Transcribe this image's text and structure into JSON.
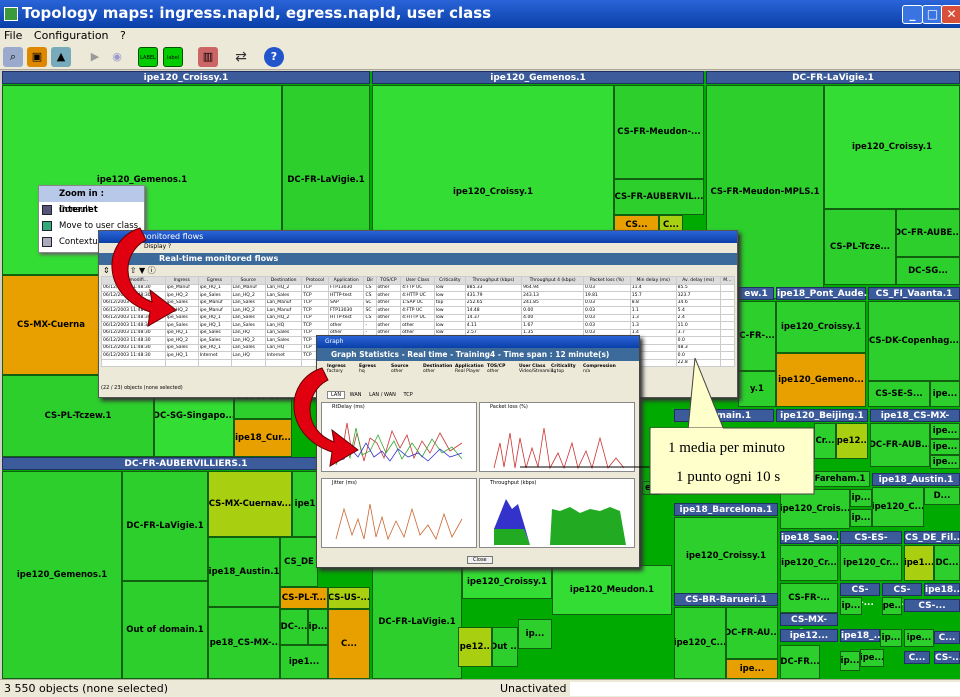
{
  "window": {
    "title": "Topology maps: ingress.napId, egress.napId, user class",
    "min": "_",
    "max": "□",
    "close": "✕"
  },
  "menu": [
    "File",
    "Configuration",
    "?"
  ],
  "toolbar": {
    "icons": [
      "search-icon",
      "lock-icon",
      "map-icon",
      "play-icon",
      "refresh-icon",
      "label-icon",
      "label2-icon",
      "filter-icon",
      "swap-icon",
      "help-icon"
    ]
  },
  "tree": {
    "headers": [
      "ipe120_Croissy.1",
      "ipe120_Gemenos.1",
      "DC-FR-LaVigie.1",
      "DC-FR-AUBERVILLIERS.1"
    ],
    "cells": [
      "ipe120_Gemenos.1",
      "DC-FR-LaVigie.1",
      "ipe120_Croissy.1",
      "CS-FR-Meudon-...",
      "CS-FR-AUBERVIL...",
      "CS-FR-Meudon-MPLS.1",
      "ipe120_Croissy.1",
      "DC-FR-AUBE...",
      "CS-PL-Tcze...",
      "DC-SG...",
      "CS...",
      "C...",
      "CS-MX-Cuerna",
      "ew.1",
      "ipe18_Pont_Aude...",
      "CS_FI_Vaanta.1",
      "ipe120_Croissy.1",
      "CS-DK-Copenhag...",
      "C-FR-...",
      "ipe120_Gemeno...",
      "CS-SE-S...",
      "ip...",
      "ipe...",
      "CS-PL-Tczew.1",
      "DC-SG-Singapo...",
      "Out of do...",
      "ipe18_Cur...",
      "y.1",
      "f domain.1",
      "ipe120_Beijing.1",
      "ipe18_CS-MX-Izt...",
      "ipe12...",
      "Cr...",
      "DC-FR-AUB...",
      "ipe...",
      "ipe...",
      "ipe...",
      "ipe120_Gemenos.1",
      "DC-FR-LaVigie.1",
      "CS-MX-Cuernav...",
      "ipe1",
      "ipe18_Austin.1",
      "CS_DE",
      "CS-PL-T...",
      "CS-US-...",
      "Out of domain.1",
      "ipe18_CS-MX-...",
      "DC-...",
      "ip...",
      "ipe1...",
      "C...",
      "ipe120_Croissy.1",
      "ipe120_Meudon.1",
      "DC-FR-LaVigie.1",
      "ipe12...",
      "Out ...",
      "ip...",
      "Fareham.1",
      "ipe18_Austin.1",
      "ip...",
      "D...",
      "ip...",
      "ipe120_Crois...",
      "ipe120_C...",
      "ipe18_Barcelona.1",
      "ipe18_Sao...",
      "CS-ES-Madr...",
      "CS_DE_Fil...",
      "ipe120_Croissy.1",
      "ipe120_Cr...",
      "ipe120_Cr...",
      "ipe1...",
      "DC...",
      "CS-US-...",
      "CS-FR...",
      "ipe18...",
      "CS-BR-Barueri.1",
      "CS-FR-...",
      "ip...",
      "CS-MX-Cu...",
      "ipe...",
      "CS-...",
      "ipe120_C...",
      "DC-FR-AU...",
      "ipe12...",
      "ipe18_...",
      "ip...",
      "ipe...",
      "C...",
      "DC-FR...",
      "ipe...",
      "ipe...",
      "C...",
      "CS-...",
      "ip...",
      "eu"
    ]
  },
  "context_menu": {
    "items": [
      "Zoom in : internet",
      "Consult",
      "Move to user class",
      "Contextual fl..."
    ]
  },
  "flows_window": {
    "wintitle": "monitored flows",
    "menu": "Display  ?",
    "title": "Real-time monitored flows",
    "columns": [
      "Last modifi...",
      "Ingress",
      "Egress",
      "Source",
      "Destination",
      "Protocol",
      "Application",
      "Dir",
      "TOS/CP",
      "User Class",
      "Criticality",
      "Throughput (kbps)",
      "Throughput 4 (kbps)",
      "Packet loss (%)",
      "Min delay (ms)",
      "Av. delay (ms)",
      "M..."
    ],
    "rows": [
      [
        "06/12/2003 11:48:30",
        "ipe_Manuf",
        "ipe_HQ_1",
        "Lan_Manuf",
        "Lan_HQ_2",
        "TCP",
        "FTP13030",
        "CS",
        "other",
        "4:FTP UC",
        "low",
        "885.33",
        "964.94",
        "0.03",
        "11.4",
        "85.5",
        ""
      ],
      [
        "06/12/2003 11:48:30",
        "ipe_HQ_2",
        "ipe_Sales",
        "Lan_HQ_2",
        "Lan_Sales",
        "TCP",
        "HTTP-test",
        "CS",
        "other",
        "4:HTTP UC",
        "low",
        "431.79",
        "243.13",
        "19.81",
        "15.7",
        "323.7",
        ""
      ],
      [
        "06/12/2003 11:48:30",
        "ipe_Sales",
        "ipe_Manuf",
        "Lan_Sales",
        "Lan_Manuf",
        "TCP",
        "SAP",
        "SC",
        "other",
        "1:SAP UC",
        "top",
        "252.65",
        "241.85",
        "0.03",
        "8.8",
        "34.6",
        ""
      ],
      [
        "06/12/2003 11:48:30",
        "ipe_HQ_2",
        "ipe_Manuf",
        "Lan_HQ_2",
        "Lan_Manuf",
        "TCP",
        "FTP13030",
        "SC",
        "other",
        "4:FTP UC",
        "low",
        "14.48",
        "0.00",
        "0.03",
        "1.1",
        "5.4",
        ""
      ],
      [
        "06/12/2003 11:48:30",
        "ipe_Sales",
        "ipe_HQ_1",
        "Lan_Sales",
        "Lan_HQ_2",
        "TCP",
        "HTTP-test",
        "CS",
        "other",
        "4:HTTP UC",
        "low",
        "14.37",
        "4.00",
        "0.03",
        "1.3",
        "2.4",
        ""
      ],
      [
        "06/12/2003 11:48:30",
        "ipe_Sales",
        "ipe_HQ_1",
        "Lan_Sales",
        "Lan_HQ",
        "TCP",
        "other",
        "-",
        "other",
        "other",
        "low",
        "4.11",
        "1.67",
        "0.03",
        "1.3",
        "11.0",
        ""
      ],
      [
        "06/12/2003 11:48:30",
        "ipe_HQ_1",
        "ipe_Sales",
        "Lan_HQ",
        "Lan_Sales",
        "TCP",
        "other",
        "-",
        "other",
        "other",
        "low",
        "2.57",
        "1.35",
        "0.03",
        "1.4",
        "3.7",
        ""
      ],
      [
        "06/12/2003 11:48:30",
        "ipe_HQ_2",
        "ipe_Sales",
        "Lan_HQ_2",
        "Lan_Sales",
        "TCP",
        "oth",
        "",
        "",
        "",
        "",
        "",
        "",
        "",
        "0.0",
        "0.0",
        ""
      ],
      [
        "06/12/2003 11:48:30",
        "ipe_Sales",
        "ipe_HQ_1",
        "Lan_Sales",
        "Lan_HQ",
        "TCP",
        "oth",
        "",
        "",
        "",
        "",
        "",
        "",
        "",
        "1.2",
        "48.3",
        ""
      ],
      [
        "06/12/2003 11:48:30",
        "ipe_HQ_1",
        "Internet",
        "Lan_HQ",
        "Internet",
        "TCP",
        "oth",
        "",
        "",
        "",
        "",
        "",
        "",
        "",
        "0.0",
        "0.0",
        ""
      ],
      [
        "",
        "",
        "",
        "",
        "",
        "",
        "",
        "",
        "",
        "",
        "",
        "",
        "",
        "",
        "2.3",
        "22.8",
        ""
      ]
    ],
    "footer": "(22 / 23) objects (none selected)"
  },
  "graph_window": {
    "wintitle": "Graph",
    "title": "Graph Statistics - Real time - Training4 - Time span : 12 minute(s)",
    "info_headers": [
      "Ingress",
      "Egress",
      "Source",
      "Destination",
      "Application",
      "TOS/CP",
      "User Class",
      "Criticality",
      "Compression"
    ],
    "info_values": [
      "factory",
      "hq",
      "other",
      "other",
      "Real Player",
      "other",
      "Video/Streaming",
      "1. top",
      "n/a"
    ],
    "tabs": [
      "LAN",
      "WAN",
      "LAN / WAN",
      "TCP"
    ],
    "panels": [
      "RtDelay (ms)",
      "Packet loss (%)",
      "Jitter (ms)",
      "Throughput (kbps)"
    ],
    "close": "Close"
  },
  "callout": {
    "line1": "1 media per minuto",
    "line2": "1 punto ogni 10 s"
  },
  "status": {
    "left": "3 550 objects (none selected)",
    "right": "Unactivated filter"
  }
}
